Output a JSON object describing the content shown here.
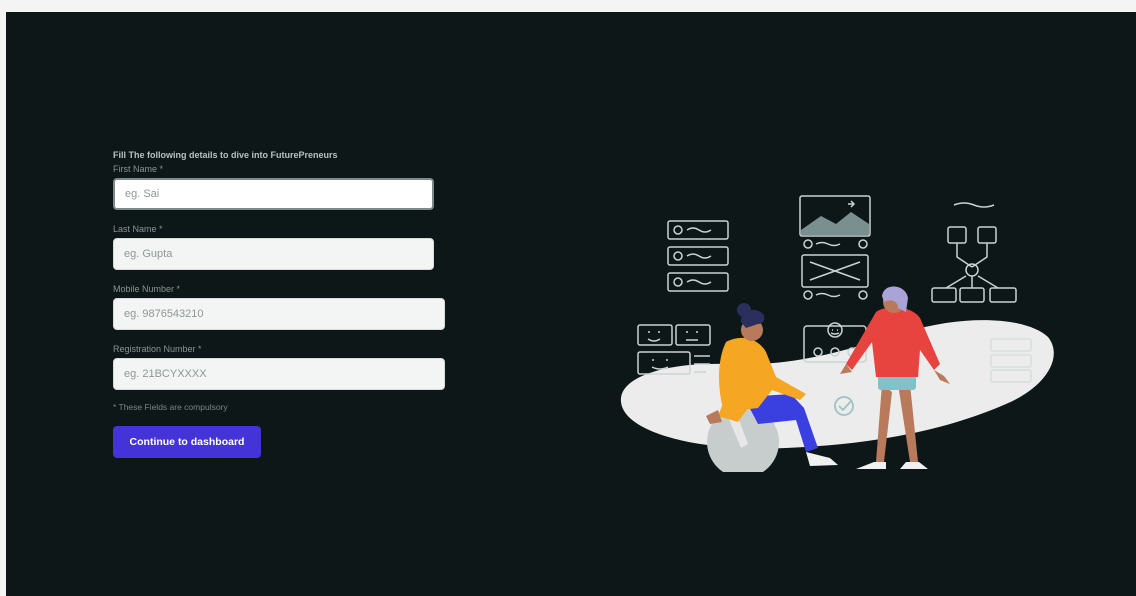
{
  "form": {
    "heading": "Fill The following details to dive into FuturePreneurs",
    "fields": [
      {
        "label": "First Name *",
        "placeholder": "eg. Sai"
      },
      {
        "label": "Last Name *",
        "placeholder": "eg. Gupta"
      },
      {
        "label": "Mobile Number *",
        "placeholder": "eg. 9876543210"
      },
      {
        "label": "Registration Number *",
        "placeholder": "eg. 21BCYXXXX"
      }
    ],
    "note": "* These Fields are compulsory",
    "submit_label": "Continue to dashboard"
  },
  "colors": {
    "background": "#0d1717",
    "button": "#4433d6",
    "illustration_blob": "#eeeeee"
  },
  "illustration": {
    "icons": [
      "collaboration-illustration",
      "wireframe-cards-icon",
      "image-placeholder-icon",
      "flowchart-icon",
      "emoji-cards-icon",
      "checkmark-icon"
    ]
  }
}
